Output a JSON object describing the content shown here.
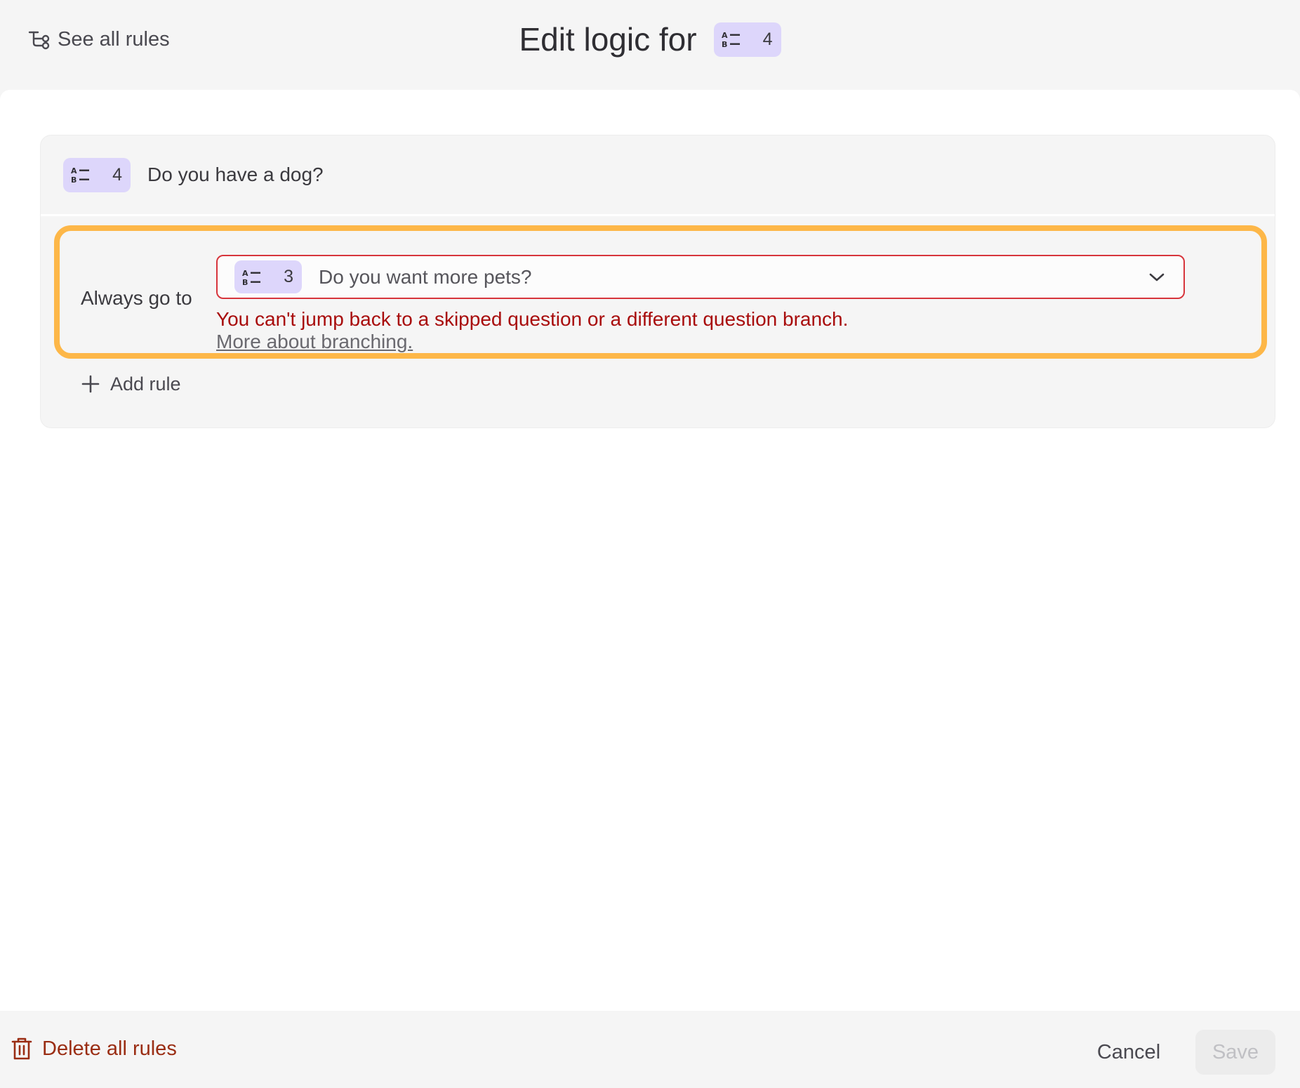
{
  "header": {
    "back_label": "See all rules",
    "title": "Edit logic for",
    "question_badge": {
      "icon": "ab-list-icon",
      "number": "4"
    }
  },
  "question": {
    "badge": {
      "icon": "ab-list-icon",
      "number": "4"
    },
    "text": "Do you have a dog?"
  },
  "rule": {
    "label": "Always go to",
    "select": {
      "badge": {
        "icon": "ab-list-icon",
        "number": "3"
      },
      "value": "Do you want more pets?"
    },
    "error": "You can't jump back to a skipped question or a different question branch.",
    "help_link": "More about branching."
  },
  "add_rule_label": "Add rule",
  "footer": {
    "delete_label": "Delete all rules",
    "cancel_label": "Cancel",
    "save_label": "Save"
  },
  "colors": {
    "badge_bg": "#ddd6fb",
    "highlight_border": "#fdb748",
    "error": "#a80c0c",
    "danger": "#9a2d13"
  }
}
